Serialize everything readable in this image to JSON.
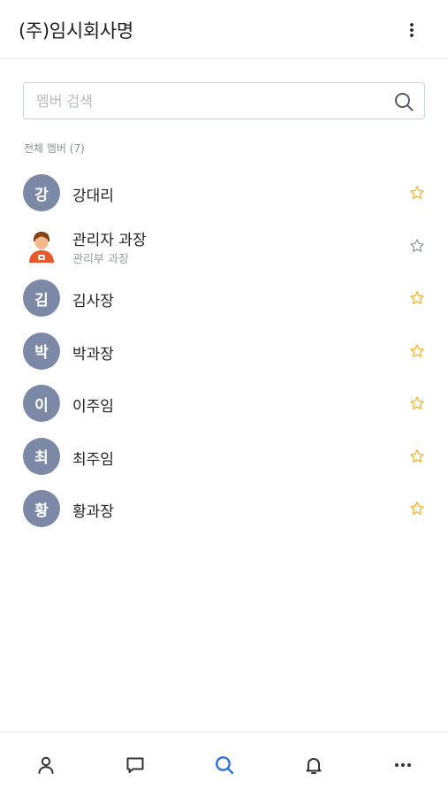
{
  "header": {
    "title": "(주)임시회사명",
    "menu_icon": "more-vertical-icon"
  },
  "search": {
    "placeholder": "멤버 검색",
    "value": "",
    "icon": "search-icon"
  },
  "section_label": "전체 멤버 (7)",
  "members": [
    {
      "initial": "강",
      "name": "강대리",
      "subtitle": "",
      "avatar": "initial",
      "favorite": true
    },
    {
      "initial": "",
      "name": "관리자 과장",
      "subtitle": "관리부 과장",
      "avatar": "person-image",
      "favorite": false
    },
    {
      "initial": "김",
      "name": "김사장",
      "subtitle": "",
      "avatar": "initial",
      "favorite": true
    },
    {
      "initial": "박",
      "name": "박과장",
      "subtitle": "",
      "avatar": "initial",
      "favorite": true
    },
    {
      "initial": "이",
      "name": "이주임",
      "subtitle": "",
      "avatar": "initial",
      "favorite": true
    },
    {
      "initial": "최",
      "name": "최주임",
      "subtitle": "",
      "avatar": "initial",
      "favorite": true
    },
    {
      "initial": "황",
      "name": "황과장",
      "subtitle": "",
      "avatar": "initial",
      "favorite": true
    }
  ],
  "bottom_nav": {
    "items": [
      {
        "icon": "person-icon",
        "active": false
      },
      {
        "icon": "chat-icon",
        "active": false
      },
      {
        "icon": "search-icon",
        "active": true
      },
      {
        "icon": "bell-icon",
        "active": false
      },
      {
        "icon": "more-horizontal-icon",
        "active": false
      }
    ]
  },
  "colors": {
    "avatar_bg": "#7b88a6",
    "star_active": "#f5b82e",
    "star_inactive": "#8c929c",
    "nav_icon": "#333333",
    "nav_active": "#2f6fd6",
    "divider": "#e6e8ec"
  }
}
